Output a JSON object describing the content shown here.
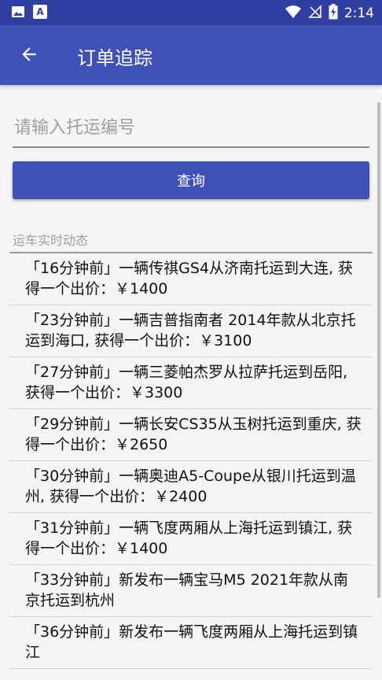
{
  "status_bar": {
    "time": "2:14",
    "icons": [
      "image-icon",
      "a-letter-icon",
      "wifi-icon",
      "no-signal-icon",
      "battery-charging-icon"
    ],
    "letter_icon_text": "A"
  },
  "app_bar": {
    "title": "订单追踪",
    "back_icon": "arrow-left-icon"
  },
  "search": {
    "placeholder": "请输入托运编号",
    "value": "",
    "button_label": "查询"
  },
  "feed": {
    "label": "运车实时动态",
    "items": [
      "「16分钟前」一辆传祺GS4从济南托运到大连, 获得一个出价：￥1400",
      "「23分钟前」一辆吉普指南者 2014年款从北京托运到海口, 获得一个出价：￥3100",
      "「27分钟前」一辆三菱帕杰罗从拉萨托运到岳阳, 获得一个出价：￥3300",
      "「29分钟前」一辆长安CS35从玉树托运到重庆, 获得一个出价：￥2650",
      "「30分钟前」一辆奥迪A5-Coupe从银川托运到温州, 获得一个出价：￥2400",
      "「31分钟前」一辆飞度两厢从上海托运到镇江, 获得一个出价：￥1400",
      "「33分钟前」新发布一辆宝马M5 2021年款从南京托运到杭州",
      "「36分钟前」新发布一辆飞度两厢从上海托运到镇江"
    ]
  },
  "colors": {
    "status_bar": "#303f9f",
    "primary": "#3f51b5",
    "background": "#f5f5f5"
  }
}
